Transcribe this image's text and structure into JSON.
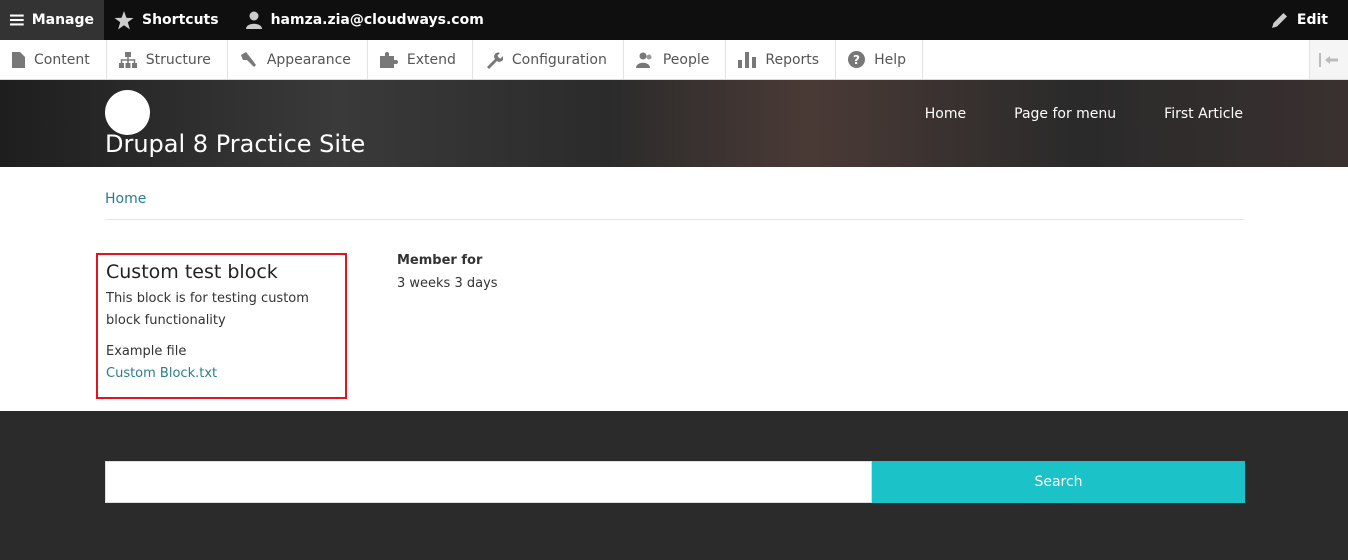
{
  "toolbar": {
    "manage": "Manage",
    "shortcuts": "Shortcuts",
    "user": "hamza.zia@cloudways.com",
    "edit": "Edit"
  },
  "tray": {
    "items": [
      "Content",
      "Structure",
      "Appearance",
      "Extend",
      "Configuration",
      "People",
      "Reports",
      "Help"
    ]
  },
  "header": {
    "site_name": "Drupal 8 Practice Site",
    "nav": [
      "Home",
      "Page for menu",
      "First Article"
    ]
  },
  "breadcrumb": "Home",
  "block": {
    "title": "Custom test block",
    "body": "This block is for testing custom block functionality",
    "file_label": "Example file",
    "file_link": "Custom Block.txt"
  },
  "member": {
    "label": "Member for",
    "value": "3 weeks 3 days"
  },
  "footer": {
    "search_button": "Search"
  },
  "colors": {
    "accent": "#1bc2c8",
    "link": "#2c7c8c",
    "highlight_border": "#e0131f"
  }
}
